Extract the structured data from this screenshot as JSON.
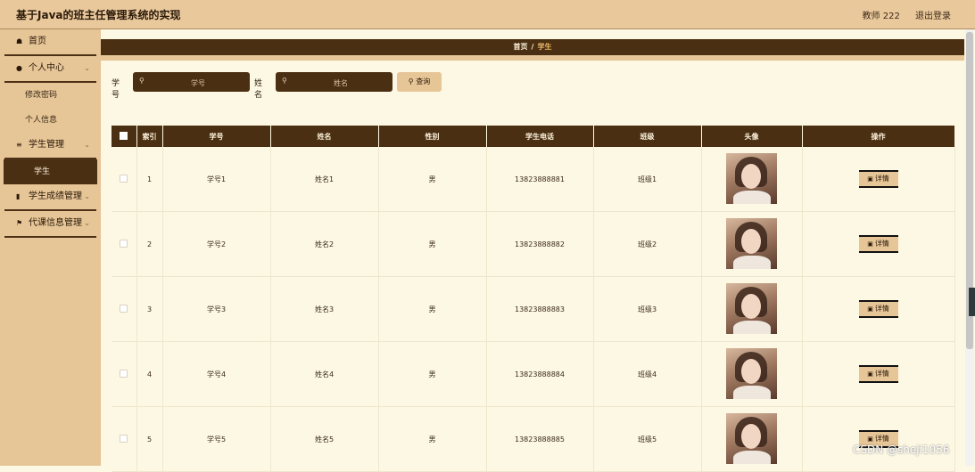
{
  "app": {
    "title": "基于Java的班主任管理系统的实现",
    "user_label": "教师 222",
    "logout_label": "退出登录"
  },
  "sidebar": {
    "home": "首页",
    "personal_center": "个人中心",
    "change_password": "修改密码",
    "personal_info": "个人信息",
    "student_mgmt": "学生管理",
    "student": "学生",
    "score_mgmt": "学生成绩管理",
    "substitute_mgmt": "代课信息管理"
  },
  "breadcrumb": {
    "home": "首页",
    "sep": "/",
    "current": "学生"
  },
  "search": {
    "student_no_label": "学号",
    "student_no_placeholder": "学号",
    "name_label": "姓名",
    "name_placeholder": "姓名",
    "query_button": "查询"
  },
  "table": {
    "headers": [
      "索引",
      "学号",
      "姓名",
      "性别",
      "学生电话",
      "班级",
      "头像",
      "操作"
    ],
    "detail_label": "详情",
    "rows": [
      {
        "index": "1",
        "student_no": "学号1",
        "name": "姓名1",
        "gender": "男",
        "phone": "13823888881",
        "class": "班级1"
      },
      {
        "index": "2",
        "student_no": "学号2",
        "name": "姓名2",
        "gender": "男",
        "phone": "13823888882",
        "class": "班级2"
      },
      {
        "index": "3",
        "student_no": "学号3",
        "name": "姓名3",
        "gender": "男",
        "phone": "13823888883",
        "class": "班级3"
      },
      {
        "index": "4",
        "student_no": "学号4",
        "name": "姓名4",
        "gender": "男",
        "phone": "13823888884",
        "class": "班级4"
      },
      {
        "index": "5",
        "student_no": "学号5",
        "name": "姓名5",
        "gender": "男",
        "phone": "13823888885",
        "class": "班级5"
      }
    ]
  },
  "watermark": "CSDN @sheji1056",
  "colors": {
    "brown": "#4a2f12",
    "tan": "#e6c597",
    "cream": "#fdf8e4"
  },
  "icons": [
    "home-icon",
    "user-icon",
    "sliders-icon",
    "chart-icon",
    "flag-icon",
    "search-icon",
    "chevron-down-icon",
    "detail-icon"
  ]
}
